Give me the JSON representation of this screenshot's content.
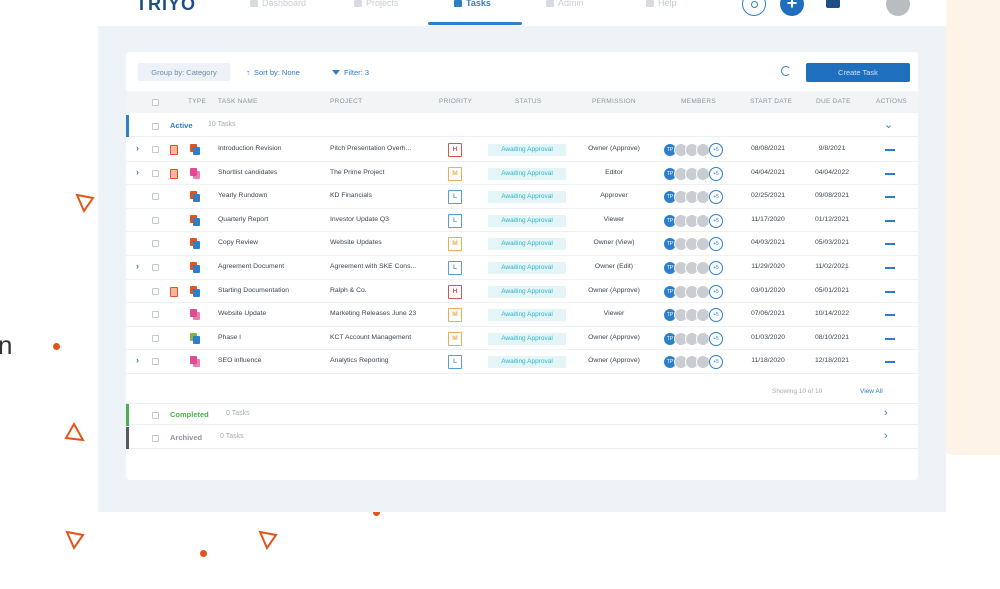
{
  "nav": {
    "logo": "TRIYO",
    "items": [
      {
        "label": "Dashboard"
      },
      {
        "label": "Projects"
      },
      {
        "label": "Tasks"
      },
      {
        "label": "Admin"
      },
      {
        "label": "Help"
      }
    ],
    "add_label": "+"
  },
  "toolbar": {
    "group_by": "Group by: Category",
    "sort_by": "Sort by: None",
    "filter": "Filter: 3",
    "create_task": "Create Task"
  },
  "table": {
    "headers": [
      "TYPE",
      "TASK NAME",
      "PROJECT",
      "PRIORITY",
      "STATUS",
      "PERMISSION",
      "MEMBERS",
      "START DATE",
      "DUE DATE",
      "ACTIONS"
    ],
    "groups": {
      "active": {
        "label": "Active",
        "count": "10 Tasks"
      },
      "completed": {
        "label": "Completed",
        "count": "0 Tasks"
      },
      "archived": {
        "label": "Archived",
        "count": "0 Tasks"
      }
    },
    "rows": [
      {
        "task": "Introduction Revision",
        "project": "Pitch Presentation Overh...",
        "priority": "H",
        "status": "Awaiting Approval",
        "permission": "Owner (Approve)",
        "member_initials": "TP",
        "more": "+5",
        "start": "08/08/2021",
        "due": "9/8/2021"
      },
      {
        "task": "Shortlist candidates",
        "project": "The Prime Project",
        "priority": "M",
        "status": "Awaiting Approval",
        "permission": "Editor",
        "member_initials": "TP",
        "more": "+5",
        "start": "04/04/2021",
        "due": "04/04/2022"
      },
      {
        "task": "Yearly Rundown",
        "project": "KD Financials",
        "priority": "L",
        "status": "Awaiting Approval",
        "permission": "Approver",
        "member_initials": "TP",
        "more": "+5",
        "start": "02/25/2021",
        "due": "09/08/2021"
      },
      {
        "task": "Quarterly Report",
        "project": "Investor Update Q3",
        "priority": "L",
        "status": "Awaiting Approval",
        "permission": "Viewer",
        "member_initials": "TP",
        "more": "+5",
        "start": "11/17/2020",
        "due": "01/12/2021"
      },
      {
        "task": "Copy Review",
        "project": "Website Updates",
        "priority": "M",
        "status": "Awaiting Approval",
        "permission": "Owner (View)",
        "member_initials": "TP",
        "more": "+5",
        "start": "04/03/2021",
        "due": "05/03/2021"
      },
      {
        "task": "Agreement Document",
        "project": "Agreement with SKE Cons...",
        "priority": "L",
        "status": "Awaiting Approval",
        "permission": "Owner (Edit)",
        "member_initials": "TP",
        "more": "+5",
        "start": "11/29/2020",
        "due": "11/02/2021"
      },
      {
        "task": "Starting Documentation",
        "project": "Ralph & Co.",
        "priority": "H",
        "status": "Awaiting Approval",
        "permission": "Owner (Approve)",
        "member_initials": "TP",
        "more": "+5",
        "start": "03/01/2020",
        "due": "05/01/2021"
      },
      {
        "task": "Website Update",
        "project": "Marketing Releases June 23",
        "priority": "M",
        "status": "Awaiting Approval",
        "permission": "Viewer",
        "member_initials": "TP",
        "more": "+5",
        "start": "07/06/2021",
        "due": "10/14/2022"
      },
      {
        "task": "Phase I",
        "project": "KCT Account Management",
        "priority": "M",
        "status": "Awaiting Approval",
        "permission": "Owner (Approve)",
        "member_initials": "TP",
        "more": "+5",
        "start": "01/03/2020",
        "due": "08/10/2021"
      },
      {
        "task": "SEO influence",
        "project": "Analytics Reporting",
        "priority": "L",
        "status": "Awaiting Approval",
        "permission": "Owner (Approve)",
        "member_initials": "TP",
        "more": "+5",
        "start": "11/18/2020",
        "due": "12/18/2021"
      }
    ],
    "showing": "Showing 10 of 10",
    "view_all": "View All"
  },
  "colors": {
    "accent": "#2d7fc9",
    "primary_button": "#1f6fbf",
    "status_text": "#2bb4c8",
    "priority_high": "#d9534f",
    "priority_medium": "#f0ad4e",
    "priority_low": "#5b9bd5",
    "decor_orange": "#e2541b",
    "completed_green": "#4caf50"
  }
}
